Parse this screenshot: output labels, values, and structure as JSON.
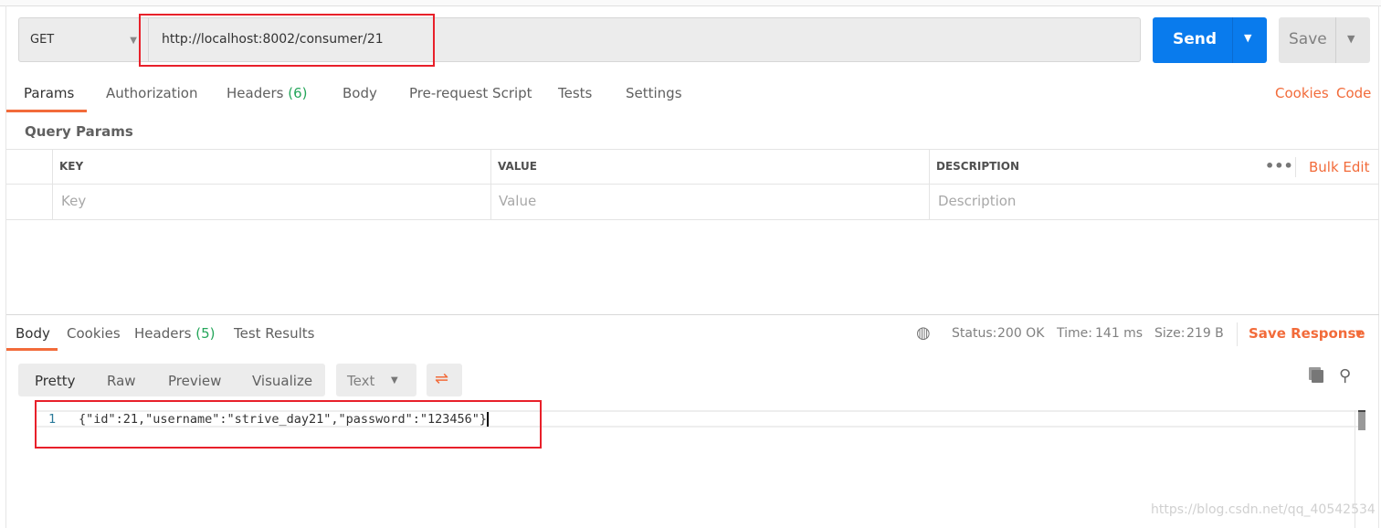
{
  "request": {
    "method": "GET",
    "url": "http://localhost:8002/consumer/21",
    "send_label": "Send",
    "save_label": "Save"
  },
  "request_tabs": [
    {
      "label": "Params"
    },
    {
      "label": "Authorization"
    },
    {
      "label": "Headers",
      "count": "(6)"
    },
    {
      "label": "Body"
    },
    {
      "label": "Pre-request Script"
    },
    {
      "label": "Tests"
    },
    {
      "label": "Settings"
    }
  ],
  "right_links": {
    "cookies": "Cookies",
    "code": "Code"
  },
  "query_params": {
    "title": "Query Params",
    "headers": [
      "KEY",
      "VALUE",
      "DESCRIPTION"
    ],
    "bulk_edit": "Bulk Edit",
    "placeholders": [
      "Key",
      "Value",
      "Description"
    ]
  },
  "response_tabs": [
    {
      "label": "Body"
    },
    {
      "label": "Cookies"
    },
    {
      "label": "Headers",
      "count": "(5)"
    },
    {
      "label": "Test Results"
    }
  ],
  "status": {
    "status_label": "Status:",
    "status": "200 OK",
    "time_label": "Time:",
    "time": "141 ms",
    "size_label": "Size:",
    "size": "219 B",
    "save_response": "Save Response"
  },
  "view_modes": [
    "Pretty",
    "Raw",
    "Preview",
    "Visualize"
  ],
  "format": "Text",
  "body": {
    "line_number": "1",
    "content": "{\"id\":21,\"username\":\"strive_day21\",\"password\":\"123456\"}"
  },
  "watermark": "https://blog.csdn.net/qq_40542534",
  "colors": {
    "accent": "#f26b3a",
    "send": "#097bed",
    "success": "#26a65b",
    "highlight": "#e8202a"
  }
}
